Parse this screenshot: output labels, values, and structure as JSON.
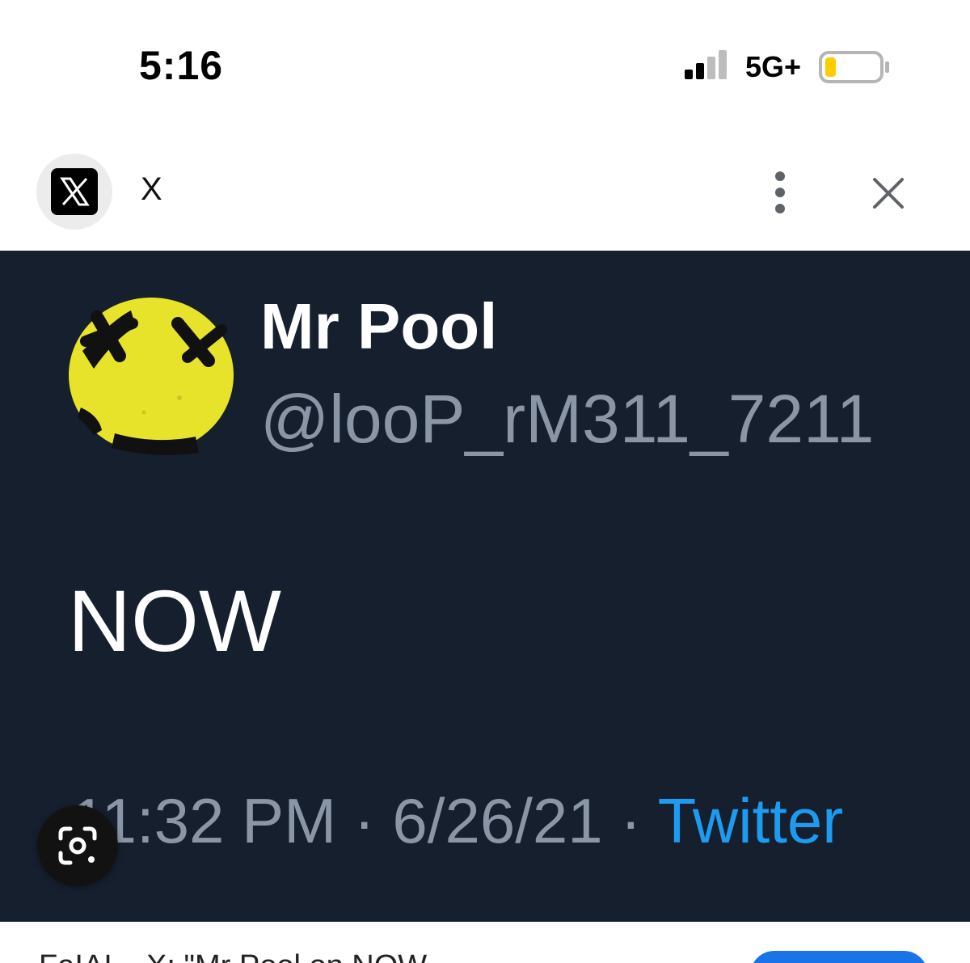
{
  "status_bar": {
    "time": "5:16",
    "network": "5G+",
    "battery_level": 0.2,
    "signal_bars": 2,
    "icons": [
      "signal-icon",
      "battery-icon"
    ]
  },
  "browser": {
    "site_title": "X",
    "site_icon": "x-logo-icon",
    "more_icon": "more-vertical-icon",
    "close_icon": "close-icon"
  },
  "tweet": {
    "display_name": "Mr Pool",
    "handle": "@looP_rM311_7211",
    "text": "NOW",
    "time": "11:32 PM",
    "separator": " · ",
    "date": "6/26/21",
    "source": "Twitter",
    "colors": {
      "background": "#161f2e",
      "secondary_text": "#8a96a6",
      "link": "#1d9bf0"
    }
  },
  "lens": {
    "icon": "lens-search-icon"
  },
  "bottom": {
    "caption": "FaIAI... X: \"Mr Pool on NOW"
  }
}
